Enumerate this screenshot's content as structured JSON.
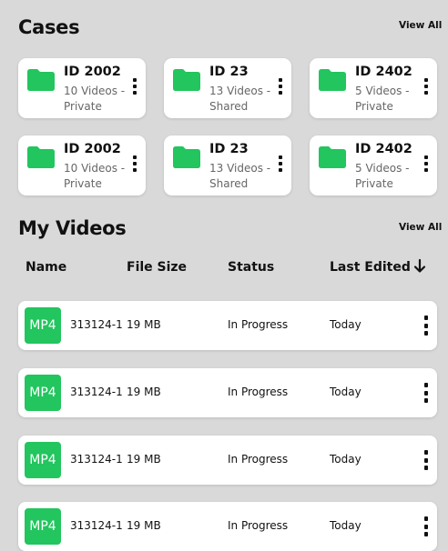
{
  "colors": {
    "background": "#d9d9d9",
    "card": "#ffffff",
    "accent_green": "#22c55e",
    "text": "#111111",
    "muted": "#666666"
  },
  "cases": {
    "title": "Cases",
    "view_all": "View All",
    "items": [
      {
        "id": "ID 2002",
        "line1": "10 Videos -",
        "line2": "Private"
      },
      {
        "id": "ID 23",
        "line1": "13 Videos -",
        "line2": "Shared"
      },
      {
        "id": "ID 2402",
        "line1": "5 Videos -",
        "line2": "Private"
      },
      {
        "id": "ID 2002",
        "line1": "10 Videos -",
        "line2": "Private"
      },
      {
        "id": "ID 23",
        "line1": "13 Videos -",
        "line2": "Shared"
      },
      {
        "id": "ID 2402",
        "line1": "5 Videos -",
        "line2": "Private"
      }
    ]
  },
  "videos": {
    "title": "My Videos",
    "view_all": "View All",
    "columns": {
      "name": "Name",
      "size": "File Size",
      "status": "Status",
      "edited": "Last Edited"
    },
    "sort_icon": "arrow-down-icon",
    "rows": [
      {
        "type": "MP4",
        "name": "313124-1",
        "size": "19 MB",
        "status": "In Progress",
        "edited": "Today"
      },
      {
        "type": "MP4",
        "name": "313124-1",
        "size": "19 MB",
        "status": "In Progress",
        "edited": "Today"
      },
      {
        "type": "MP4",
        "name": "313124-1",
        "size": "19 MB",
        "status": "In Progress",
        "edited": "Today"
      },
      {
        "type": "MP4",
        "name": "313124-1",
        "size": "19 MB",
        "status": "In Progress",
        "edited": "Today"
      }
    ]
  }
}
